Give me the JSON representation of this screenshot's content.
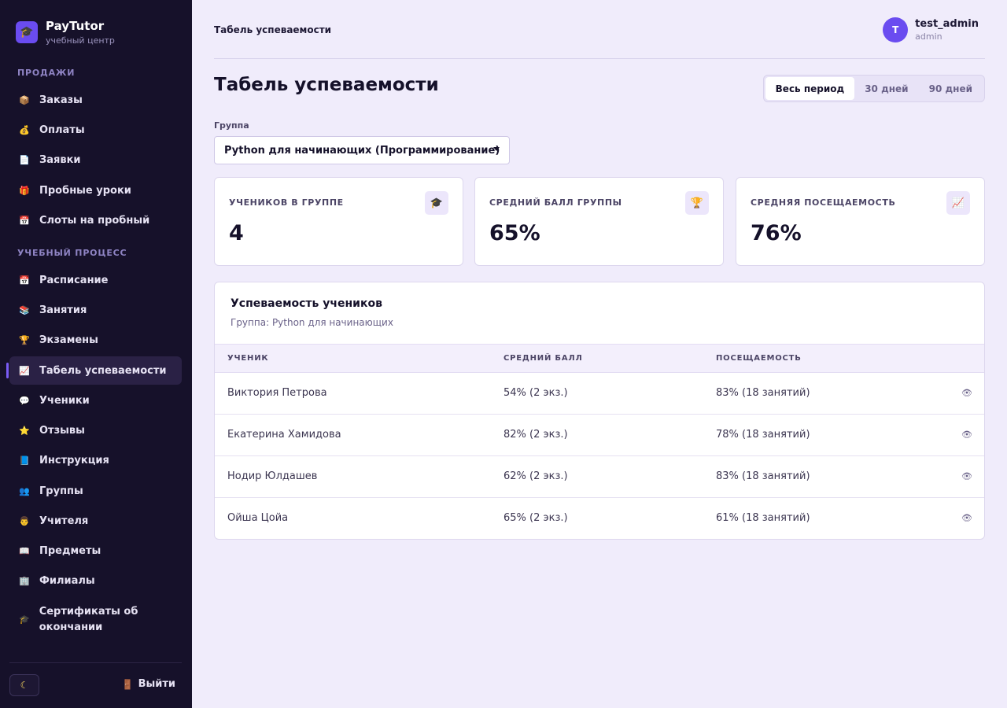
{
  "brand": {
    "name": "PayTutor",
    "subtitle": "учебный центр",
    "logo_icon": "graduation-cap-icon"
  },
  "sidebar": {
    "sections": [
      {
        "title": "ПРОДАЖИ"
      },
      {
        "title": "УЧЕБНЫЙ ПРОЦЕСС"
      }
    ],
    "items": [
      {
        "label": "Заказы",
        "icon": "package-icon"
      },
      {
        "label": "Оплаты",
        "icon": "money-bag-icon"
      },
      {
        "label": "Заявки",
        "icon": "document-icon"
      },
      {
        "label": "Пробные уроки",
        "icon": "gift-icon"
      },
      {
        "label": "Слоты на пробный",
        "icon": "calendar-icon"
      },
      {
        "label": "Расписание",
        "icon": "calendar-icon"
      },
      {
        "label": "Занятия",
        "icon": "books-icon"
      },
      {
        "label": "Экзамены",
        "icon": "trophy-icon"
      },
      {
        "label": "Табель успеваемости",
        "icon": "chart-icon",
        "active": true
      },
      {
        "label": "Ученики",
        "icon": "speech-bubble-icon"
      },
      {
        "label": "Отзывы",
        "icon": "star-icon"
      },
      {
        "label": "Инструкция",
        "icon": "book-icon"
      },
      {
        "label": "Группы",
        "icon": "people-icon"
      },
      {
        "label": "Учителя",
        "icon": "teacher-icon"
      },
      {
        "label": "Предметы",
        "icon": "open-book-icon"
      },
      {
        "label": "Филиалы",
        "icon": "building-icon"
      },
      {
        "label": "Сертификаты об окончании",
        "icon": "graduation-cap-icon"
      }
    ],
    "theme_toggle_icon": "moon-icon",
    "logout_label": "Выйти",
    "logout_icon": "door-icon"
  },
  "header": {
    "breadcrumb": "Табель успеваемости",
    "user": {
      "initial": "T",
      "name": "test_admin",
      "role": "admin"
    }
  },
  "page": {
    "title": "Табель успеваемости",
    "period_options": [
      {
        "label": "Весь период",
        "active": true
      },
      {
        "label": "30 дней",
        "active": false
      },
      {
        "label": "90 дней",
        "active": false
      }
    ],
    "group_label": "Группа",
    "group_selected": "Python для начинающих (Программирование)"
  },
  "stats": [
    {
      "label": "УЧЕНИКОВ В ГРУППЕ",
      "value": "4",
      "icon": "graduation-cap-icon"
    },
    {
      "label": "СРЕДНИЙ БАЛЛ ГРУППЫ",
      "value": "65%",
      "icon": "trophy-icon"
    },
    {
      "label": "СРЕДНЯЯ ПОСЕЩАЕМОСТЬ",
      "value": "76%",
      "icon": "chart-icon"
    }
  ],
  "table": {
    "title": "Успеваемость учеников",
    "subtitle": "Группа: Python для начинающих",
    "columns": [
      "УЧЕНИК",
      "СРЕДНИЙ БАЛЛ",
      "ПОСЕЩАЕМОСТЬ"
    ],
    "rows": [
      {
        "name": "Виктория Петрова",
        "score": "54% (2 экз.)",
        "attendance": "83% (18 занятий)"
      },
      {
        "name": "Екатерина Хамидова",
        "score": "82% (2 экз.)",
        "attendance": "78% (18 занятий)"
      },
      {
        "name": "Нодир Юлдашев",
        "score": "62% (2 экз.)",
        "attendance": "83% (18 занятий)"
      },
      {
        "name": "Ойша Цойа",
        "score": "65% (2 экз.)",
        "attendance": "61% (18 занятий)"
      }
    ],
    "row_action_icon": "eye-icon"
  }
}
